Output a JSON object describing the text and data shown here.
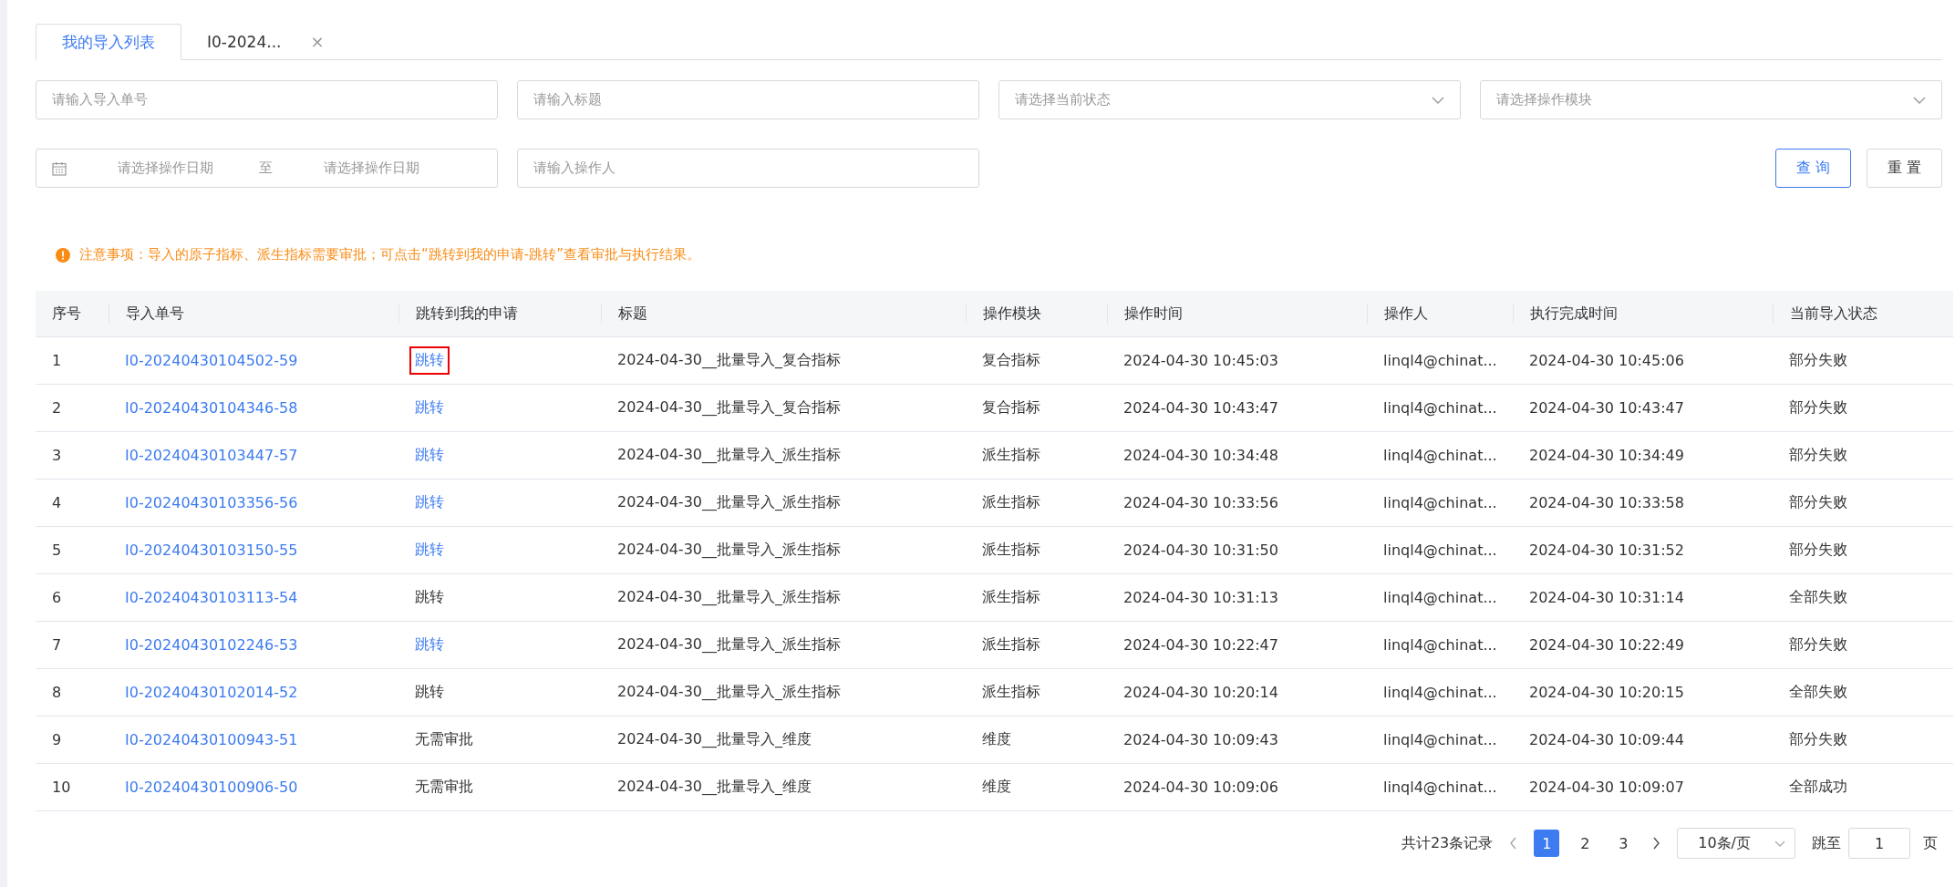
{
  "tabs": [
    {
      "label": "我的导入列表",
      "selected": true,
      "closable": false
    },
    {
      "label": "I0-2024...",
      "selected": false,
      "closable": true
    }
  ],
  "close_glyph": "×",
  "filters": [
    {
      "kind": "input",
      "placeholder": "请输入导入单号"
    },
    {
      "kind": "input",
      "placeholder": "请输入标题"
    },
    {
      "kind": "select",
      "placeholder": "请选择当前状态"
    },
    {
      "kind": "select",
      "placeholder": "请选择操作模块"
    },
    {
      "kind": "daterange",
      "start_placeholder": "请选择操作日期",
      "separator": "至",
      "end_placeholder": "请选择操作日期"
    },
    {
      "kind": "input",
      "placeholder": "请输入操作人"
    }
  ],
  "buttons": [
    {
      "label": "查 询",
      "kind": "primary"
    },
    {
      "label": "重 置",
      "kind": "default"
    }
  ],
  "notice": "注意事项：导入的原子指标、派生指标需要审批；可点击“跳转到我的申请-跳转”查看审批与执行结果。",
  "table": {
    "columns": [
      "序号",
      "导入单号",
      "跳转到我的申请",
      "标题",
      "操作模块",
      "操作时间",
      "操作人",
      "执行完成时间",
      "当前导入状态"
    ],
    "rows": [
      {
        "index": "1",
        "number": "I0-20240430104502-59",
        "jump": {
          "text": "跳转",
          "link": true,
          "highlighted": true
        },
        "title": "2024-04-30__批量导入_复合指标",
        "module": "复合指标",
        "time": "2024-04-30 10:45:03",
        "operator": "linql4@chinat...",
        "done_time": "2024-04-30 10:45:06",
        "status": "部分失败"
      },
      {
        "index": "2",
        "number": "I0-20240430104346-58",
        "jump": {
          "text": "跳转",
          "link": true,
          "highlighted": false
        },
        "title": "2024-04-30__批量导入_复合指标",
        "module": "复合指标",
        "time": "2024-04-30 10:43:47",
        "operator": "linql4@chinat...",
        "done_time": "2024-04-30 10:43:47",
        "status": "部分失败"
      },
      {
        "index": "3",
        "number": "I0-20240430103447-57",
        "jump": {
          "text": "跳转",
          "link": true,
          "highlighted": false
        },
        "title": "2024-04-30__批量导入_派生指标",
        "module": "派生指标",
        "time": "2024-04-30 10:34:48",
        "operator": "linql4@chinat...",
        "done_time": "2024-04-30 10:34:49",
        "status": "部分失败"
      },
      {
        "index": "4",
        "number": "I0-20240430103356-56",
        "jump": {
          "text": "跳转",
          "link": true,
          "highlighted": false
        },
        "title": "2024-04-30__批量导入_派生指标",
        "module": "派生指标",
        "time": "2024-04-30 10:33:56",
        "operator": "linql4@chinat...",
        "done_time": "2024-04-30 10:33:58",
        "status": "部分失败"
      },
      {
        "index": "5",
        "number": "I0-20240430103150-55",
        "jump": {
          "text": "跳转",
          "link": true,
          "highlighted": false
        },
        "title": "2024-04-30__批量导入_派生指标",
        "module": "派生指标",
        "time": "2024-04-30 10:31:50",
        "operator": "linql4@chinat...",
        "done_time": "2024-04-30 10:31:52",
        "status": "部分失败"
      },
      {
        "index": "6",
        "number": "I0-20240430103113-54",
        "jump": {
          "text": "跳转",
          "link": false,
          "highlighted": false
        },
        "title": "2024-04-30__批量导入_派生指标",
        "module": "派生指标",
        "time": "2024-04-30 10:31:13",
        "operator": "linql4@chinat...",
        "done_time": "2024-04-30 10:31:14",
        "status": "全部失败"
      },
      {
        "index": "7",
        "number": "I0-20240430102246-53",
        "jump": {
          "text": "跳转",
          "link": true,
          "highlighted": false
        },
        "title": "2024-04-30__批量导入_派生指标",
        "module": "派生指标",
        "time": "2024-04-30 10:22:47",
        "operator": "linql4@chinat...",
        "done_time": "2024-04-30 10:22:49",
        "status": "部分失败"
      },
      {
        "index": "8",
        "number": "I0-20240430102014-52",
        "jump": {
          "text": "跳转",
          "link": false,
          "highlighted": false
        },
        "title": "2024-04-30__批量导入_派生指标",
        "module": "派生指标",
        "time": "2024-04-30 10:20:14",
        "operator": "linql4@chinat...",
        "done_time": "2024-04-30 10:20:15",
        "status": "全部失败"
      },
      {
        "index": "9",
        "number": "I0-20240430100943-51",
        "jump": {
          "text": "无需审批",
          "link": false,
          "highlighted": false
        },
        "title": "2024-04-30__批量导入_维度",
        "module": "维度",
        "time": "2024-04-30 10:09:43",
        "operator": "linql4@chinat...",
        "done_time": "2024-04-30 10:09:44",
        "status": "部分失败"
      },
      {
        "index": "10",
        "number": "I0-20240430100906-50",
        "jump": {
          "text": "无需审批",
          "link": false,
          "highlighted": false
        },
        "title": "2024-04-30__批量导入_维度",
        "module": "维度",
        "time": "2024-04-30 10:09:06",
        "operator": "linql4@chinat...",
        "done_time": "2024-04-30 10:09:07",
        "status": "全部成功"
      }
    ]
  },
  "pagination": {
    "total": "共计23条记录",
    "pages": [
      {
        "label": "1",
        "selected": true
      },
      {
        "label": "2",
        "selected": false
      },
      {
        "label": "3",
        "selected": false
      }
    ],
    "page_size": "10条/页",
    "jump_label": "跳至",
    "jump_value": "1",
    "page_unit": "页"
  }
}
